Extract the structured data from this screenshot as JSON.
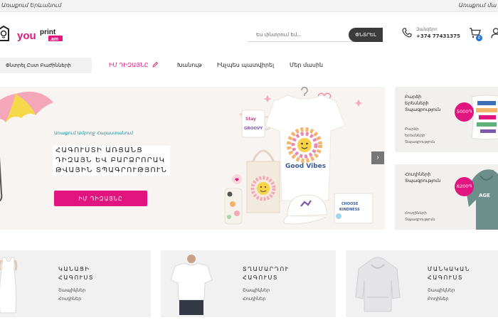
{
  "top_strip": {
    "left_text": "Առաքում Երևանում",
    "right_text": "Առաքում մա"
  },
  "header": {
    "search": {
      "placeholder": "Ես փնտրում եմ...",
      "button_label": "ՓՆՏՐԵԼ"
    },
    "phone": {
      "label": "Զանգերո",
      "number": "+374 77431375"
    },
    "cart": {
      "count": "0"
    },
    "icons": {
      "phone": "phone-icon",
      "cart": "cart-icon",
      "user": "user-icon"
    }
  },
  "logo": {
    "primary": "you",
    "secondary": "print",
    "suffix": ".am"
  },
  "nav": {
    "categories_button": "Փնտրել Ըստ Բաժինների",
    "items": [
      {
        "label": "ԻՄ ԴԻԶԱՅՆԸ",
        "icon": "pencil-icon"
      },
      {
        "label": "Խանութ"
      },
      {
        "label": "Ինչպես պատվիրել"
      },
      {
        "label": "Մեր մասին"
      }
    ]
  },
  "hero": {
    "subtitle": "Առաքում Ամբողջ Հայաստանում",
    "title_lines": [
      "ՀԱԳՈՒՍՏԻ ԱՌՑԱՆՑ",
      "ԴԻԶԱՅՆ ԵՎ ԲԱՐՁՐՈՐԱԿ",
      "ԹՎԱՅԻՆ ՏՊԱԳՐՈՒԹՅՈՒՆ"
    ],
    "cta": "ԻՄ ԴԻԶԱՅՆԸ",
    "next_arrow": "›",
    "artwork_text": {
      "mug": [
        "Stay",
        "GROOVY"
      ],
      "tshirt": "Good Vibes",
      "mat": [
        "CHOOSE",
        "KINDNESS"
      ]
    }
  },
  "promos": [
    {
      "title_lines": [
        "Բարձի",
        "Երեսների",
        "Տպագրություն"
      ],
      "price": "5000֏",
      "links": [
        "Բարձի",
        "Երեսների",
        "Տպագրություն"
      ]
    },
    {
      "title_lines": [
        "Հուդիների",
        "Տպագրություն"
      ],
      "price": "6200֏",
      "links": [
        "Հուդիների",
        "Տպագրություն"
      ],
      "art_text": "AGE"
    }
  ],
  "categories": [
    {
      "title_lines": [
        "ԿԱՆԱՑԻ",
        "ՀԱԳՈՒՍՏ"
      ],
      "links": [
        "Շապիկներ",
        "Հուդիներ"
      ]
    },
    {
      "title_lines": [
        "ՏՂԱՄԱՐԴՈՒ",
        "ՀԱԳՈՒՍՏ"
      ],
      "links": [
        "Շապիկներ",
        "Հուդիներ"
      ]
    },
    {
      "title_lines": [
        "ՄԱՆԿԱԿԱՆ",
        "ՀԱԳՈՒՍՏ"
      ],
      "links": [
        "Շապիկներ",
        "Բոդիներ"
      ]
    }
  ],
  "colors": {
    "accent": "#e0157f",
    "teal": "#1f8c92",
    "dark": "#3b3b3b",
    "badge_blue": "#1a73e8"
  }
}
